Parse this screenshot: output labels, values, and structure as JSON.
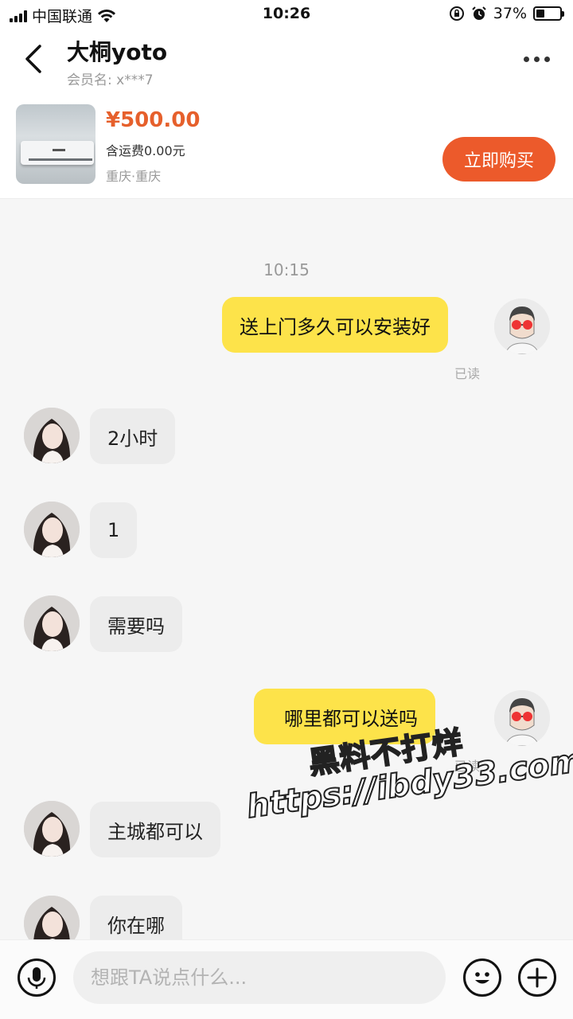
{
  "status_bar": {
    "carrier": "中国联通",
    "time": "10:26",
    "battery": "37%",
    "battery_level": 0.37
  },
  "header": {
    "title": "大桐yoto",
    "member_label": "会员名: x***7"
  },
  "product": {
    "price": "¥500.00",
    "shipping": "含运费0.00元",
    "location": "重庆·重庆",
    "buy_label": "立即购买"
  },
  "chat": {
    "timestamp": "10:15",
    "read_label": "已读",
    "messages": [
      {
        "from": "me",
        "text": "送上门多久可以安装好",
        "read": "已读"
      },
      {
        "from": "them",
        "text": "2小时"
      },
      {
        "from": "them",
        "text": "1"
      },
      {
        "from": "them",
        "text": "需要吗"
      },
      {
        "from": "me",
        "text": "哪里都可以送吗",
        "read": "已读"
      },
      {
        "from": "them",
        "text": "主城都可以"
      },
      {
        "from": "them",
        "text": "你在哪"
      }
    ]
  },
  "watermark": {
    "line1": "黑料不打烊",
    "line2": "https://ibdy33.com"
  },
  "input_bar": {
    "placeholder": "想跟TA说点什么..."
  },
  "icons": [
    "back-arrow-icon",
    "more-icon",
    "microphone-icon",
    "emoji-icon",
    "plus-icon",
    "wifi-icon",
    "signal-icon",
    "lock-rotation-icon",
    "alarm-icon",
    "battery-icon"
  ]
}
